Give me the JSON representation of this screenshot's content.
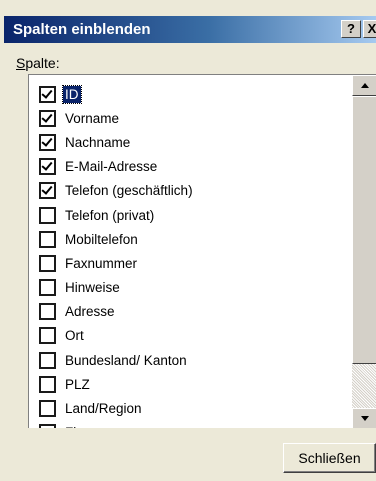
{
  "dialog": {
    "title": "Spalten einblenden",
    "help_symbol": "?",
    "close_symbol": "X",
    "list_label_accel": "S",
    "list_label_rest": "palte:",
    "close_button": "Schließen"
  },
  "columns": [
    {
      "label": "ID",
      "checked": true,
      "selected": true
    },
    {
      "label": "Vorname",
      "checked": true
    },
    {
      "label": "Nachname",
      "checked": true
    },
    {
      "label": "E-Mail-Adresse",
      "checked": true
    },
    {
      "label": "Telefon (geschäftlich)",
      "checked": true
    },
    {
      "label": "Telefon (privat)",
      "checked": false
    },
    {
      "label": "Mobiltelefon",
      "checked": false
    },
    {
      "label": "Faxnummer",
      "checked": false
    },
    {
      "label": "Hinweise",
      "checked": false
    },
    {
      "label": "Adresse",
      "checked": false
    },
    {
      "label": "Ort",
      "checked": false
    },
    {
      "label": "Bundesland/ Kanton",
      "checked": false
    },
    {
      "label": "PLZ",
      "checked": false
    },
    {
      "label": "Land/Region",
      "checked": false
    },
    {
      "label": "Firma",
      "checked": true
    }
  ],
  "icons": {
    "scroll_up": "arrow-up-icon",
    "scroll_down": "arrow-down-icon"
  }
}
